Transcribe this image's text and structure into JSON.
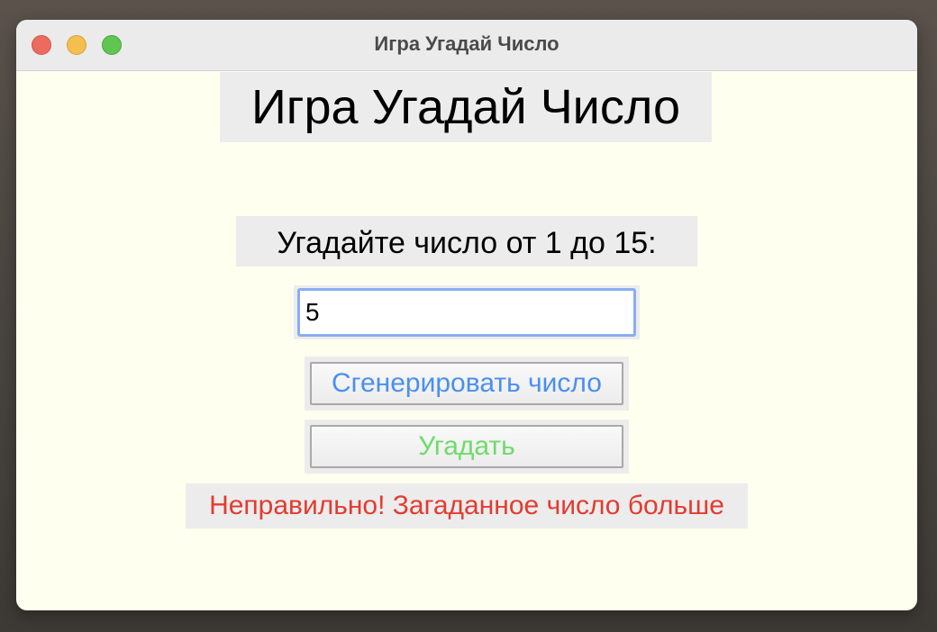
{
  "window": {
    "title": "Игра Угадай Число"
  },
  "main": {
    "heading": "Игра Угадай Число",
    "prompt": "Угадайте число от 1 до 15:",
    "guess_input": {
      "value": "5"
    },
    "generate_button_label": "Сгенерировать число",
    "guess_button_label": "Угадать",
    "result_text": "Неправильно! Загаданное число больше"
  },
  "colors": {
    "content_background": "#fffff0",
    "label_background": "#ececec",
    "generate_text": "#4a8ff0",
    "guess_text": "#6fdb6a",
    "result_text": "#e33b30",
    "input_focus_border": "#89aef2"
  }
}
